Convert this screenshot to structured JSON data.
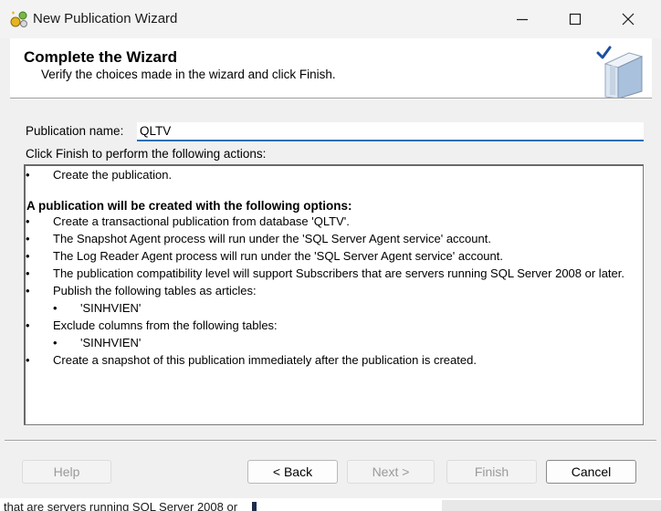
{
  "window": {
    "title": "New Publication Wizard",
    "app_icon": "wizard-app-icon",
    "controls": {
      "minimize": "minimize-icon",
      "maximize": "maximize-icon",
      "close": "close-icon"
    }
  },
  "header": {
    "title": "Complete the Wizard",
    "subtitle": "Verify the choices made in the wizard and click Finish.",
    "graphic": "wizard-book-checkmark-icon"
  },
  "form": {
    "publication_name_label": "Publication name:",
    "publication_name_value": "QLTV",
    "actions_label": "Click Finish to perform the following actions:"
  },
  "actions": {
    "lines": [
      {
        "kind": "bullet",
        "text": "Create the publication."
      },
      {
        "kind": "blank",
        "text": ""
      },
      {
        "kind": "heading",
        "text": "A publication will be created with the following options:"
      },
      {
        "kind": "bullet",
        "text": "Create a transactional publication from database 'QLTV'."
      },
      {
        "kind": "bullet",
        "text": "The Snapshot Agent process will run under the 'SQL Server Agent service' account."
      },
      {
        "kind": "bullet",
        "text": "The Log Reader Agent process will run under the 'SQL Server Agent service' account."
      },
      {
        "kind": "bullet",
        "text": "The publication compatibility level will support Subscribers that are servers running SQL Server 2008 or later."
      },
      {
        "kind": "bullet",
        "text": "Publish the following tables as articles:"
      },
      {
        "kind": "subbullet",
        "text": "'SINHVIEN'"
      },
      {
        "kind": "bullet",
        "text": "Exclude columns from the following tables:"
      },
      {
        "kind": "subbullet",
        "text": "'SINHVIEN'"
      },
      {
        "kind": "bullet",
        "text": "Create a snapshot of this publication immediately after the publication is created."
      }
    ]
  },
  "buttons": {
    "help": "Help",
    "back": "< Back",
    "next": "Next >",
    "finish": "Finish",
    "cancel": "Cancel"
  },
  "background": {
    "partial_text": "that are servers running SQL Server 2008 or"
  },
  "colors": {
    "input_focus": "#2a6fb5",
    "header_bg": "#ffffff",
    "dialog_bg": "#f0f0f0",
    "disabled_text": "#9a9a9a"
  }
}
